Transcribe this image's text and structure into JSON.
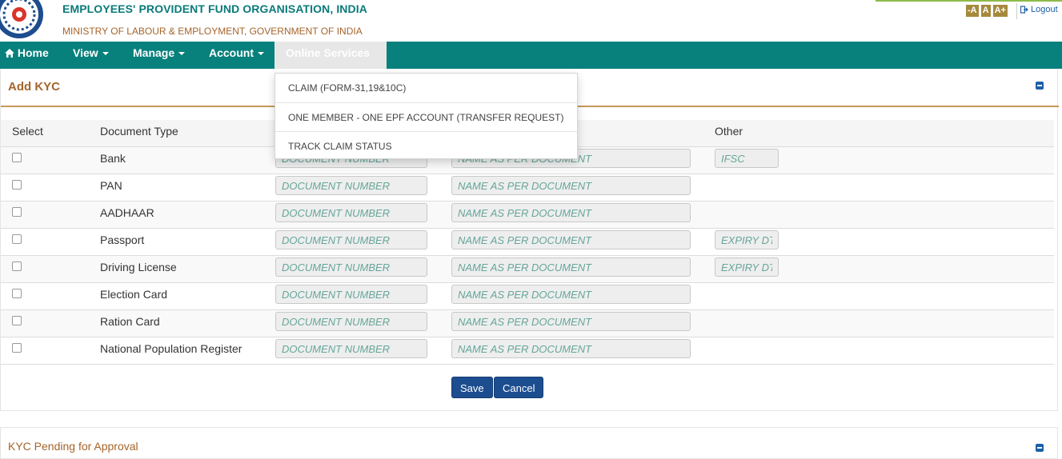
{
  "header": {
    "org_title": "EMPLOYEES' PROVIDENT FUND ORGANISATION, INDIA",
    "org_subtitle": "MINISTRY OF LABOUR & EMPLOYMENT, GOVERNMENT OF INDIA",
    "font_size_buttons": [
      "-A",
      "A",
      "A+"
    ],
    "logout_label": "Logout",
    "logo_icon": "epfo-emblem"
  },
  "nav": {
    "home": "Home",
    "view": "View",
    "manage": "Manage",
    "account": "Account",
    "online_services": "Online Services"
  },
  "dropdown": {
    "items": [
      "CLAIM (FORM-31,19&10C)",
      "ONE MEMBER - ONE EPF ACCOUNT (TRANSFER REQUEST)",
      "TRACK CLAIM STATUS"
    ]
  },
  "kyc": {
    "title": "Add KYC",
    "columns": {
      "select": "Select",
      "document_type": "Document Type",
      "other": "Other"
    },
    "placeholders": {
      "doc_number": "DOCUMENT NUMBER",
      "name": "NAME AS PER DOCUMENT"
    },
    "rows": [
      {
        "type": "Bank",
        "other": "IFSC"
      },
      {
        "type": "PAN"
      },
      {
        "type": "AADHAAR"
      },
      {
        "type": "Passport",
        "other": "EXPIRY DT"
      },
      {
        "type": "Driving License",
        "other": "EXPIRY DT"
      },
      {
        "type": "Election Card"
      },
      {
        "type": "Ration Card"
      },
      {
        "type": "National Population Register"
      }
    ],
    "save_label": "Save",
    "cancel_label": "Cancel"
  },
  "pending": {
    "title": "KYC Pending for Approval"
  },
  "colors": {
    "nav_bg": "#08807c",
    "title_teal": "#0a7a7a",
    "accent_brown": "#a5642a",
    "button_blue": "#1c4d8f"
  }
}
